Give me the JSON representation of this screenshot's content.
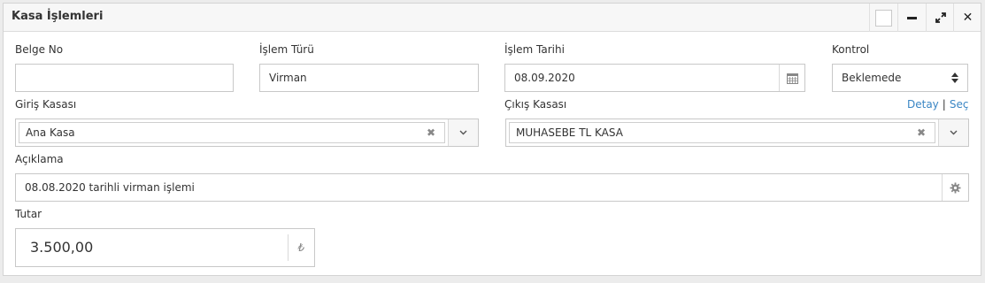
{
  "window": {
    "title": "Kasa İşlemleri"
  },
  "form": {
    "belge_no": {
      "label": "Belge No",
      "value": ""
    },
    "islem_turu": {
      "label": "İşlem Türü",
      "value": "Virman"
    },
    "islem_tarihi": {
      "label": "İşlem Tarihi",
      "value": "08.09.2020"
    },
    "kontrol": {
      "label": "Kontrol",
      "value": "Beklemede"
    },
    "giris_kasasi": {
      "label": "Giriş Kasası",
      "value": "Ana Kasa"
    },
    "cikis_kasasi": {
      "label": "Çıkış Kasası",
      "value": "MUHASEBE TL KASA"
    },
    "links": {
      "detail": "Detay",
      "separator": "|",
      "select": "Seç"
    },
    "aciklama": {
      "label": "Açıklama",
      "value": "08.08.2020 tarihli virman işlemi"
    },
    "tutar": {
      "label": "Tutar",
      "value": "3.500,00",
      "currency_symbol": "₺"
    }
  },
  "icons": {
    "titlebar": [
      "checkbox-icon",
      "minimize-icon",
      "expand-icon",
      "close-icon"
    ],
    "fields": [
      "calendar-icon",
      "sort-arrows-icon",
      "clear-x-icon",
      "chevron-down-icon",
      "gear-icon",
      "lira-icon"
    ]
  },
  "colors": {
    "link": "#3a86c4",
    "border": "#c8c8c8",
    "titlebar_bg": "#f7f7f7",
    "page_bg": "#ececec"
  }
}
